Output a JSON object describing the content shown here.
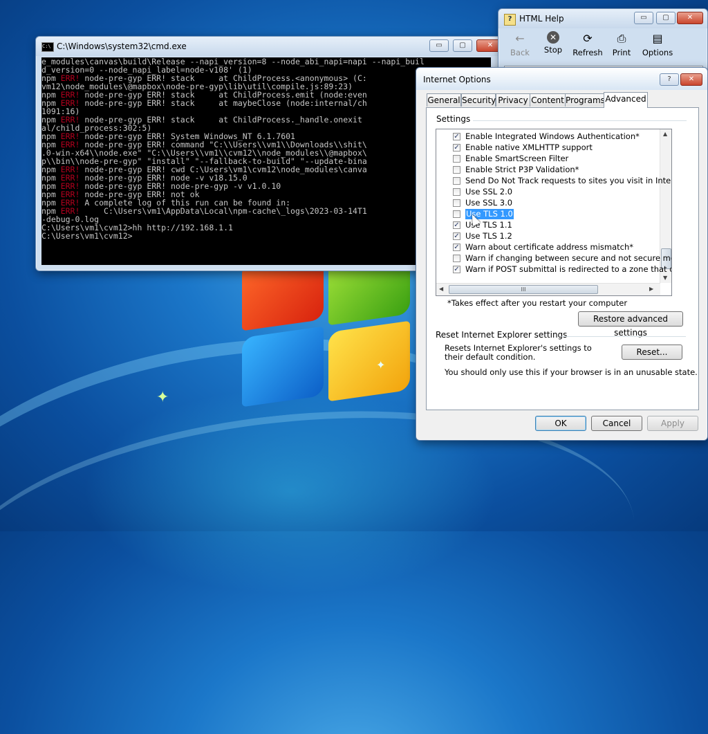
{
  "cmd": {
    "title": "C:\\Windows\\system32\\cmd.exe",
    "icon_text": "C:\\",
    "controls": {
      "minimize": "▭",
      "maximize": "▢",
      "close": "✕"
    },
    "lines": [
      {
        "pre": "e_modules\\canvas\\build\\Release --napi_version=8 --node_abi_napi=napi --napi_buil",
        "err": "",
        "post": ""
      },
      {
        "pre": "d_version=0 --node_napi_label=node-v108' (1)",
        "err": "",
        "post": ""
      },
      {
        "pre": "npm ",
        "err": "ERR!",
        "post": " node-pre-gyp ERR! stack     at ChildProcess.<anonymous> (C:"
      },
      {
        "pre": "vm12\\node_modules\\@mapbox\\node-pre-gyp\\lib\\util\\compile.js:89:23)",
        "err": "",
        "post": ""
      },
      {
        "pre": "npm ",
        "err": "ERR!",
        "post": " node-pre-gyp ERR! stack     at ChildProcess.emit (node:even"
      },
      {
        "pre": "npm ",
        "err": "ERR!",
        "post": " node-pre-gyp ERR! stack     at maybeClose (node:internal/ch"
      },
      {
        "pre": "1091:16)",
        "err": "",
        "post": ""
      },
      {
        "pre": "npm ",
        "err": "ERR!",
        "post": " node-pre-gyp ERR! stack     at ChildProcess._handle.onexit"
      },
      {
        "pre": "al/child_process:302:5)",
        "err": "",
        "post": ""
      },
      {
        "pre": "npm ",
        "err": "ERR!",
        "post": " node-pre-gyp ERR! System Windows_NT 6.1.7601"
      },
      {
        "pre": "npm ",
        "err": "ERR!",
        "post": " node-pre-gyp ERR! command \"C:\\\\Users\\\\vm1\\\\Downloads\\\\shit\\"
      },
      {
        "pre": ".0-win-x64\\\\node.exe\" \"C:\\\\Users\\\\vm1\\\\cvm12\\\\node_modules\\\\@mapbox\\",
        "err": "",
        "post": ""
      },
      {
        "pre": "p\\\\bin\\\\node-pre-gyp\" \"install\" \"--fallback-to-build\" \"--update-bina",
        "err": "",
        "post": ""
      },
      {
        "pre": "npm ",
        "err": "ERR!",
        "post": " node-pre-gyp ERR! cwd C:\\Users\\vm1\\cvm12\\node_modules\\canva"
      },
      {
        "pre": "npm ",
        "err": "ERR!",
        "post": " node-pre-gyp ERR! node -v v18.15.0"
      },
      {
        "pre": "npm ",
        "err": "ERR!",
        "post": " node-pre-gyp ERR! node-pre-gyp -v v1.0.10"
      },
      {
        "pre": "npm ",
        "err": "ERR!",
        "post": " node-pre-gyp ERR! not ok"
      },
      {
        "pre": "",
        "err": "",
        "post": ""
      },
      {
        "pre": "npm ",
        "err": "ERR!",
        "post": " A complete log of this run can be found in:"
      },
      {
        "pre": "npm ",
        "err": "ERR!",
        "post": "     C:\\Users\\vm1\\AppData\\Local\\npm-cache\\_logs\\2023-03-14T1"
      },
      {
        "pre": "-debug-0.log",
        "err": "",
        "post": ""
      },
      {
        "pre": "",
        "err": "",
        "post": ""
      },
      {
        "pre": "C:\\Users\\vm1\\cvm12>hh http://192.168.1.1",
        "err": "",
        "post": ""
      },
      {
        "pre": "",
        "err": "",
        "post": ""
      },
      {
        "pre": "C:\\Users\\vm1\\cvm12>",
        "err": "",
        "post": ""
      }
    ]
  },
  "help": {
    "title": "HTML Help",
    "icon_text": "?",
    "controls": {
      "minimize": "▭",
      "maximize": "▢",
      "close": "✕"
    },
    "toolbar": [
      {
        "label": "Back",
        "icon": "←",
        "enabled": false
      },
      {
        "label": "Stop",
        "icon": "✕",
        "enabled": true
      },
      {
        "label": "Refresh",
        "icon": "⟳",
        "enabled": true
      },
      {
        "label": "Print",
        "icon": "⎙",
        "enabled": true
      },
      {
        "label": "Options",
        "icon": "▤",
        "enabled": true
      }
    ]
  },
  "options": {
    "title": "Internet Options",
    "controls": {
      "help": "?",
      "close": "✕"
    },
    "tabs": [
      "General",
      "Security",
      "Privacy",
      "Content",
      "Programs",
      "Advanced"
    ],
    "active_tab": "Advanced",
    "settings_label": "Settings",
    "settings": [
      {
        "label": "Enable Integrated Windows Authentication*",
        "checked": true,
        "selected": false
      },
      {
        "label": "Enable native XMLHTTP support",
        "checked": true,
        "selected": false
      },
      {
        "label": "Enable SmartScreen Filter",
        "checked": false,
        "selected": false
      },
      {
        "label": "Enable Strict P3P Validation*",
        "checked": false,
        "selected": false
      },
      {
        "label": "Send Do Not Track requests to sites you visit in Internet E",
        "checked": false,
        "selected": false
      },
      {
        "label": "Use SSL 2.0",
        "checked": false,
        "selected": false
      },
      {
        "label": "Use SSL 3.0",
        "checked": false,
        "selected": false
      },
      {
        "label": "Use TLS 1.0",
        "checked": false,
        "selected": true
      },
      {
        "label": "Use TLS 1.1",
        "checked": true,
        "selected": false
      },
      {
        "label": "Use TLS 1.2",
        "checked": true,
        "selected": false
      },
      {
        "label": "Warn about certificate address mismatch*",
        "checked": true,
        "selected": false
      },
      {
        "label": "Warn if changing between secure and not secure mode",
        "checked": false,
        "selected": false
      },
      {
        "label": "Warn if POST submittal is redirected to a zone that does n",
        "checked": true,
        "selected": false
      }
    ],
    "scroll_indicator": "III",
    "restart_note": "*Takes effect after you restart your computer",
    "restore_button": "Restore advanced settings",
    "reset_group_label": "Reset Internet Explorer settings",
    "reset_desc": "Resets Internet Explorer's settings to their default condition.",
    "reset_button": "Reset...",
    "reset_warning": "You should only use this if your browser is in an unusable state.",
    "ok_button": "OK",
    "cancel_button": "Cancel",
    "apply_button": "Apply"
  }
}
